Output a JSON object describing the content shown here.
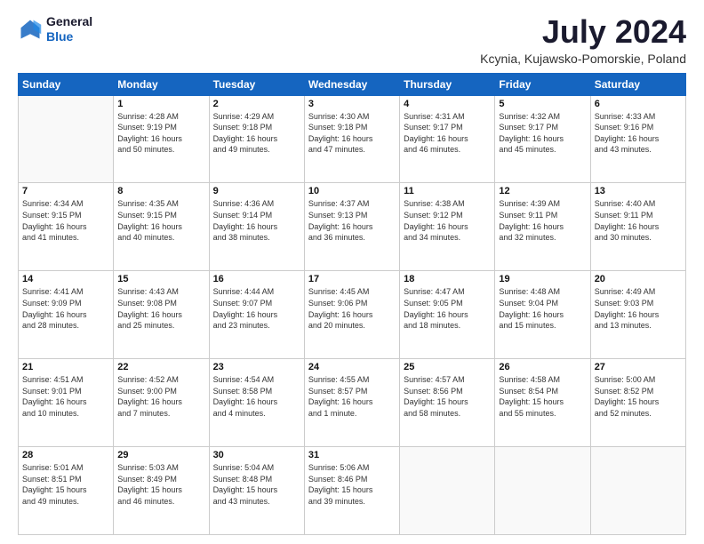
{
  "logo": {
    "line1": "General",
    "line2": "Blue"
  },
  "title": "July 2024",
  "subtitle": "Kcynia, Kujawsko-Pomorskie, Poland",
  "days_header": [
    "Sunday",
    "Monday",
    "Tuesday",
    "Wednesday",
    "Thursday",
    "Friday",
    "Saturday"
  ],
  "weeks": [
    [
      {
        "num": "",
        "info": ""
      },
      {
        "num": "1",
        "info": "Sunrise: 4:28 AM\nSunset: 9:19 PM\nDaylight: 16 hours\nand 50 minutes."
      },
      {
        "num": "2",
        "info": "Sunrise: 4:29 AM\nSunset: 9:18 PM\nDaylight: 16 hours\nand 49 minutes."
      },
      {
        "num": "3",
        "info": "Sunrise: 4:30 AM\nSunset: 9:18 PM\nDaylight: 16 hours\nand 47 minutes."
      },
      {
        "num": "4",
        "info": "Sunrise: 4:31 AM\nSunset: 9:17 PM\nDaylight: 16 hours\nand 46 minutes."
      },
      {
        "num": "5",
        "info": "Sunrise: 4:32 AM\nSunset: 9:17 PM\nDaylight: 16 hours\nand 45 minutes."
      },
      {
        "num": "6",
        "info": "Sunrise: 4:33 AM\nSunset: 9:16 PM\nDaylight: 16 hours\nand 43 minutes."
      }
    ],
    [
      {
        "num": "7",
        "info": "Sunrise: 4:34 AM\nSunset: 9:15 PM\nDaylight: 16 hours\nand 41 minutes."
      },
      {
        "num": "8",
        "info": "Sunrise: 4:35 AM\nSunset: 9:15 PM\nDaylight: 16 hours\nand 40 minutes."
      },
      {
        "num": "9",
        "info": "Sunrise: 4:36 AM\nSunset: 9:14 PM\nDaylight: 16 hours\nand 38 minutes."
      },
      {
        "num": "10",
        "info": "Sunrise: 4:37 AM\nSunset: 9:13 PM\nDaylight: 16 hours\nand 36 minutes."
      },
      {
        "num": "11",
        "info": "Sunrise: 4:38 AM\nSunset: 9:12 PM\nDaylight: 16 hours\nand 34 minutes."
      },
      {
        "num": "12",
        "info": "Sunrise: 4:39 AM\nSunset: 9:11 PM\nDaylight: 16 hours\nand 32 minutes."
      },
      {
        "num": "13",
        "info": "Sunrise: 4:40 AM\nSunset: 9:11 PM\nDaylight: 16 hours\nand 30 minutes."
      }
    ],
    [
      {
        "num": "14",
        "info": "Sunrise: 4:41 AM\nSunset: 9:09 PM\nDaylight: 16 hours\nand 28 minutes."
      },
      {
        "num": "15",
        "info": "Sunrise: 4:43 AM\nSunset: 9:08 PM\nDaylight: 16 hours\nand 25 minutes."
      },
      {
        "num": "16",
        "info": "Sunrise: 4:44 AM\nSunset: 9:07 PM\nDaylight: 16 hours\nand 23 minutes."
      },
      {
        "num": "17",
        "info": "Sunrise: 4:45 AM\nSunset: 9:06 PM\nDaylight: 16 hours\nand 20 minutes."
      },
      {
        "num": "18",
        "info": "Sunrise: 4:47 AM\nSunset: 9:05 PM\nDaylight: 16 hours\nand 18 minutes."
      },
      {
        "num": "19",
        "info": "Sunrise: 4:48 AM\nSunset: 9:04 PM\nDaylight: 16 hours\nand 15 minutes."
      },
      {
        "num": "20",
        "info": "Sunrise: 4:49 AM\nSunset: 9:03 PM\nDaylight: 16 hours\nand 13 minutes."
      }
    ],
    [
      {
        "num": "21",
        "info": "Sunrise: 4:51 AM\nSunset: 9:01 PM\nDaylight: 16 hours\nand 10 minutes."
      },
      {
        "num": "22",
        "info": "Sunrise: 4:52 AM\nSunset: 9:00 PM\nDaylight: 16 hours\nand 7 minutes."
      },
      {
        "num": "23",
        "info": "Sunrise: 4:54 AM\nSunset: 8:58 PM\nDaylight: 16 hours\nand 4 minutes."
      },
      {
        "num": "24",
        "info": "Sunrise: 4:55 AM\nSunset: 8:57 PM\nDaylight: 16 hours\nand 1 minute."
      },
      {
        "num": "25",
        "info": "Sunrise: 4:57 AM\nSunset: 8:56 PM\nDaylight: 15 hours\nand 58 minutes."
      },
      {
        "num": "26",
        "info": "Sunrise: 4:58 AM\nSunset: 8:54 PM\nDaylight: 15 hours\nand 55 minutes."
      },
      {
        "num": "27",
        "info": "Sunrise: 5:00 AM\nSunset: 8:52 PM\nDaylight: 15 hours\nand 52 minutes."
      }
    ],
    [
      {
        "num": "28",
        "info": "Sunrise: 5:01 AM\nSunset: 8:51 PM\nDaylight: 15 hours\nand 49 minutes."
      },
      {
        "num": "29",
        "info": "Sunrise: 5:03 AM\nSunset: 8:49 PM\nDaylight: 15 hours\nand 46 minutes."
      },
      {
        "num": "30",
        "info": "Sunrise: 5:04 AM\nSunset: 8:48 PM\nDaylight: 15 hours\nand 43 minutes."
      },
      {
        "num": "31",
        "info": "Sunrise: 5:06 AM\nSunset: 8:46 PM\nDaylight: 15 hours\nand 39 minutes."
      },
      {
        "num": "",
        "info": ""
      },
      {
        "num": "",
        "info": ""
      },
      {
        "num": "",
        "info": ""
      }
    ]
  ]
}
